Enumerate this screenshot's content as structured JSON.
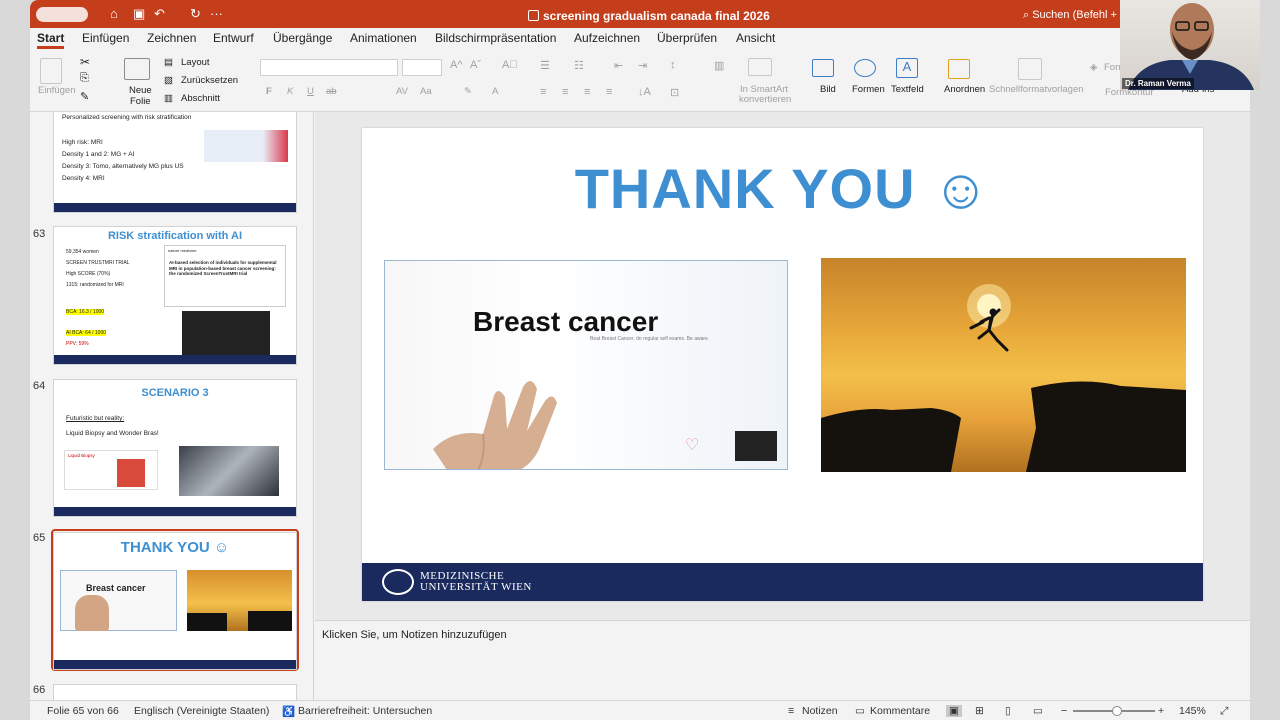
{
  "title": {
    "doc_title": "screening gradualism canada final 2026",
    "search": "Suchen (Befehl +"
  },
  "tabs": [
    "Start",
    "Einfügen",
    "Zeichnen",
    "Entwurf",
    "Übergänge",
    "Animationen",
    "Bildschirmpräsentation",
    "Aufzeichnen",
    "Überprüfen",
    "Ansicht"
  ],
  "ribbon": {
    "paste": "Einfügen",
    "new_slide": "Neue",
    "new_slide2": "Folie",
    "layout": "Layout",
    "reset": "Zurücksetzen",
    "section": "Abschnitt",
    "font_buttons": [
      "F",
      "K",
      "U",
      "ab",
      "AV",
      "Aa"
    ],
    "smartart1": "In SmartArt",
    "smartart2": "konvertieren",
    "picture": "Bild",
    "shapes": "Formen",
    "textbox": "Textfeld",
    "arrange": "Anordnen",
    "quickstyles": "Schnellformatvorlagen",
    "fill": "Form",
    "outline": "Formkontur",
    "addins": "Add-ins"
  },
  "thumbnails": {
    "s62": {
      "lines": [
        "Personalized screening with risk stratification",
        "High risk: MRI",
        "Density 1 and 2: MG + AI",
        "Density 3: Tomo, alternatively MG plus US",
        "Density 4: MRI"
      ]
    },
    "s63": {
      "num": "63",
      "title": "RISK stratification with AI",
      "lines": [
        "59,354 women",
        "SCREEN TRUSTMRI TRIAL",
        "High SCORE (70%)",
        "1315: randomized for MRI",
        "BCA: 16.3 / 1000",
        "AI BCA: 64 / 1000",
        "PPV: 59%"
      ],
      "paper": "AI-based selection of individuals for supplemental MRI in population-based breast cancer screening: the randomized ScreenTrustMRI trial",
      "journal": "nature medicine"
    },
    "s64": {
      "num": "64",
      "title": "SCENARIO 3",
      "line1": "Futuristic but reality:",
      "line2": "Liquid Biopsy and Wonder Bras!",
      "lb": "Liquid Biopsy"
    },
    "s65": {
      "num": "65",
      "title": "THANK YOU ☺",
      "bc": "Breast cancer"
    },
    "s66": {
      "num": "66"
    }
  },
  "slide": {
    "title": "THANK YOU ☺",
    "image_text": "Breast cancer",
    "image_sub": "Beat Breast Cancer, do regular self exams. Be aware.",
    "footer1": "MEDIZINISCHE",
    "footer2": "UNIVERSITÄT WIEN"
  },
  "notes": "Klicken Sie, um Notizen hinzuzufügen",
  "status": {
    "slide": "Folie 65 von 66",
    "lang": "Englisch (Vereinigte Staaten)",
    "access": "Barrierefreiheit: Untersuchen",
    "notes": "Notizen",
    "comments": "Kommentare",
    "zoom": "145%"
  },
  "video": {
    "name": "Dr. Raman Verma"
  }
}
